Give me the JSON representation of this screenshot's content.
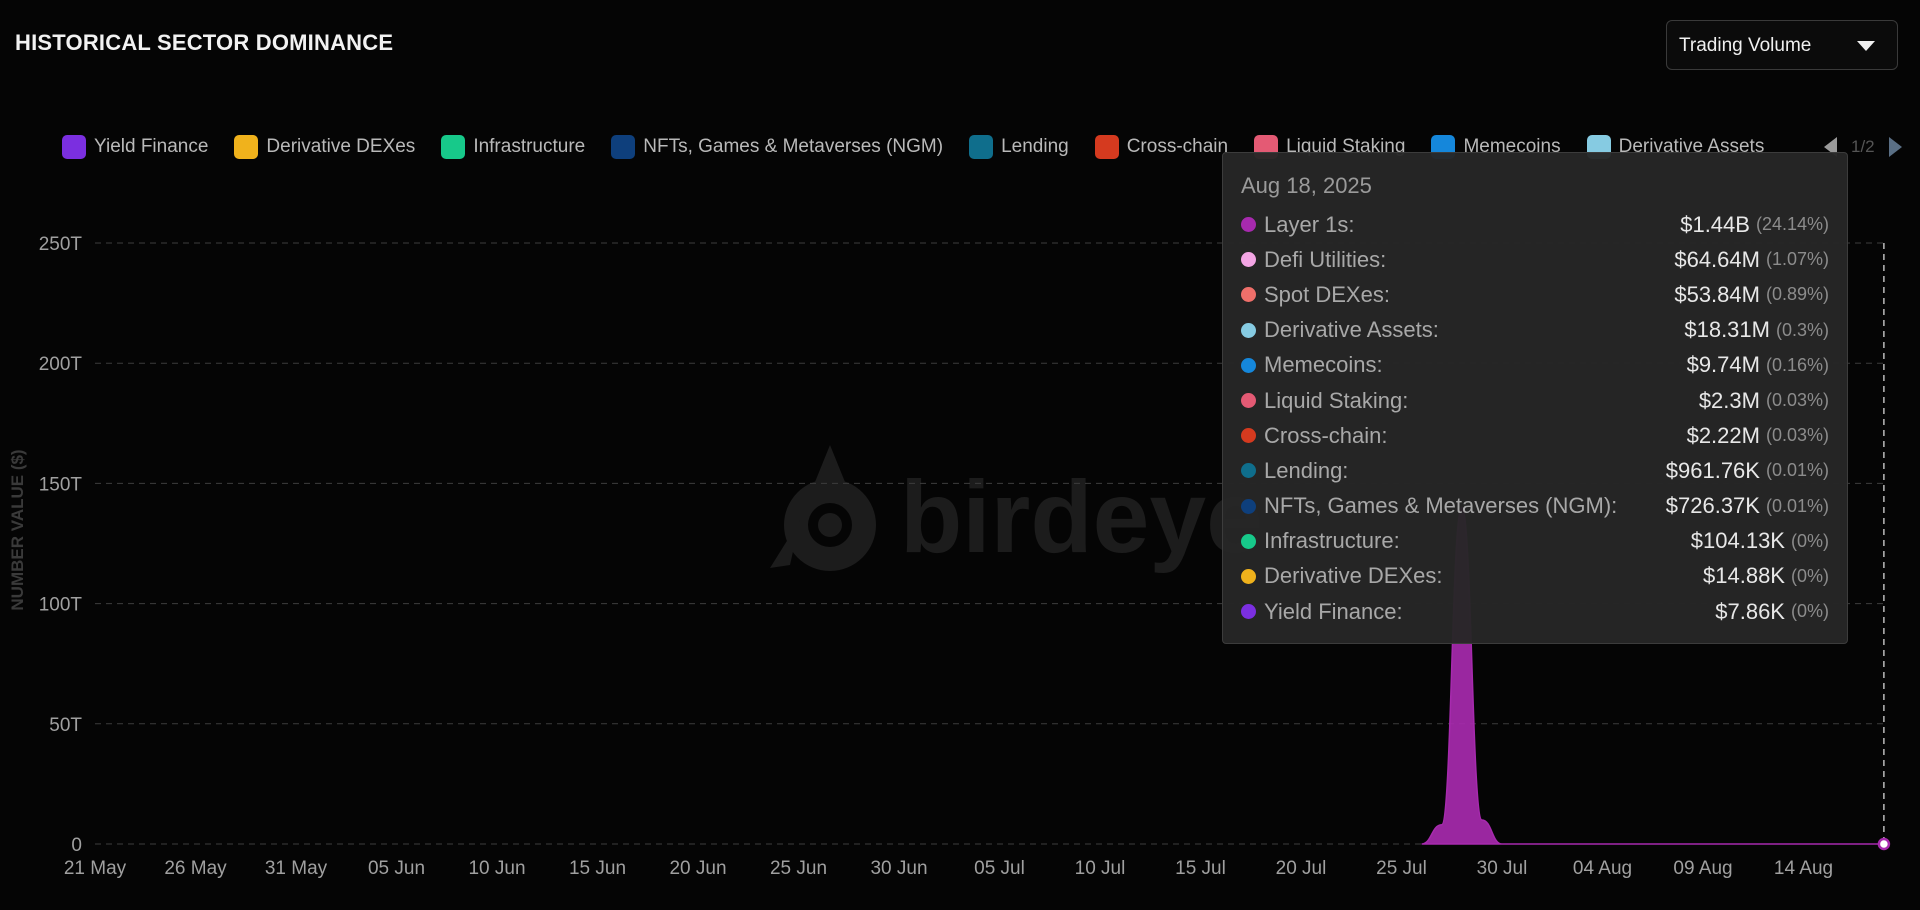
{
  "header": {
    "title": "HISTORICAL SECTOR DOMINANCE"
  },
  "metric_select": {
    "selected": "Trading Volume"
  },
  "legend": {
    "items": [
      {
        "label": "Yield Finance",
        "color": "#7B2FE0"
      },
      {
        "label": "Derivative DEXes",
        "color": "#F0B21C"
      },
      {
        "label": "Infrastructure",
        "color": "#17C98A"
      },
      {
        "label": "NFTs, Games & Metaverses (NGM)",
        "color": "#0E3F7C"
      },
      {
        "label": "Lending",
        "color": "#0F6E8C"
      },
      {
        "label": "Cross-chain",
        "color": "#D53A1F"
      },
      {
        "label": "Liquid Staking",
        "color": "#E45A74"
      },
      {
        "label": "Memecoins",
        "color": "#1587DB"
      },
      {
        "label": "Derivative Assets",
        "color": "#86CBE2"
      }
    ],
    "page": "1/2"
  },
  "watermark": {
    "text": "birdeye"
  },
  "chart_data": {
    "type": "area",
    "title": "HISTORICAL SECTOR DOMINANCE",
    "ylabel": "NUMBER VALUE ($)",
    "xlabel": "",
    "ylim": [
      0,
      250
    ],
    "y_unit": "T",
    "y_ticks": [
      "0",
      "50T",
      "100T",
      "150T",
      "200T",
      "250T"
    ],
    "x_ticks": [
      "21 May",
      "26 May",
      "31 May",
      "05 Jun",
      "10 Jun",
      "15 Jun",
      "20 Jun",
      "25 Jun",
      "30 Jun",
      "05 Jul",
      "10 Jul",
      "15 Jul",
      "20 Jul",
      "25 Jul",
      "30 Jul",
      "04 Aug",
      "09 Aug",
      "14 Aug"
    ],
    "grid": true,
    "series": [
      {
        "name": "Layer 1s",
        "color": "#A72AAE",
        "points": [
          {
            "x": "2025-07-26",
            "y": 0
          },
          {
            "x": "2025-07-27",
            "y": 8
          },
          {
            "x": "2025-07-28",
            "y": 140
          },
          {
            "x": "2025-07-29",
            "y": 10
          },
          {
            "x": "2025-07-30",
            "y": 0
          },
          {
            "x": "2025-08-18",
            "y": 0
          }
        ]
      }
    ],
    "hover": {
      "date": "Aug 18, 2025"
    }
  },
  "tooltip": {
    "date": "Aug 18, 2025",
    "rows": [
      {
        "name": "Layer 1s:",
        "value": "$1.44B",
        "pct": "(24.14%)",
        "color": "#A72AAE"
      },
      {
        "name": "Defi Utilities:",
        "value": "$64.64M",
        "pct": "(1.07%)",
        "color": "#F3A5E4"
      },
      {
        "name": "Spot DEXes:",
        "value": "$53.84M",
        "pct": "(0.89%)",
        "color": "#EF6F6A"
      },
      {
        "name": "Derivative Assets:",
        "value": "$18.31M",
        "pct": "(0.3%)",
        "color": "#86CBE2"
      },
      {
        "name": "Memecoins:",
        "value": "$9.74M",
        "pct": "(0.16%)",
        "color": "#1587DB"
      },
      {
        "name": "Liquid Staking:",
        "value": "$2.3M",
        "pct": "(0.03%)",
        "color": "#E45A74"
      },
      {
        "name": "Cross-chain:",
        "value": "$2.22M",
        "pct": "(0.03%)",
        "color": "#D53A1F"
      },
      {
        "name": "Lending:",
        "value": "$961.76K",
        "pct": "(0.01%)",
        "color": "#0F6E8C"
      },
      {
        "name": "NFTs, Games & Metaverses (NGM):",
        "value": "$726.37K",
        "pct": "(0.01%)",
        "color": "#0E3F7C"
      },
      {
        "name": "Infrastructure:",
        "value": "$104.13K",
        "pct": "(0%)",
        "color": "#17C98A"
      },
      {
        "name": "Derivative DEXes:",
        "value": "$14.88K",
        "pct": "(0%)",
        "color": "#F0B21C"
      },
      {
        "name": "Yield Finance:",
        "value": "$7.86K",
        "pct": "(0%)",
        "color": "#7B2FE0"
      }
    ]
  }
}
